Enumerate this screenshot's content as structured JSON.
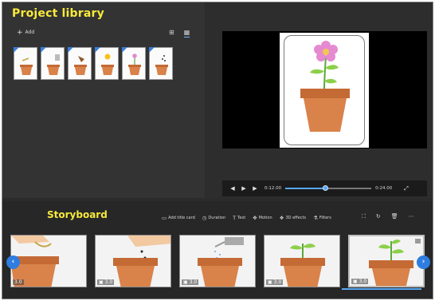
{
  "library": {
    "title": "Project library",
    "add_label": "Add",
    "view_grid_icon": "grid-view-icon",
    "view_list_icon": "list-view-icon"
  },
  "preview": {
    "current_time": "0:12.00",
    "total_time": "0:24.00",
    "progress": 0.47
  },
  "storyboard": {
    "title": "Storyboard",
    "tools": [
      {
        "icon": "title-card-icon",
        "label": "Add title card"
      },
      {
        "icon": "duration-icon",
        "label": "Duration"
      },
      {
        "icon": "text-icon",
        "label": "Text"
      },
      {
        "icon": "motion-icon",
        "label": "Motion"
      },
      {
        "icon": "3d-effects-icon",
        "label": "3D effects"
      },
      {
        "icon": "filters-icon",
        "label": "Filters"
      }
    ],
    "clips": [
      {
        "duration": "3.0"
      },
      {
        "duration": "3.0"
      },
      {
        "duration": "3.0"
      },
      {
        "duration": "3.0"
      },
      {
        "duration": "3.0"
      }
    ]
  },
  "colors": {
    "title_yellow": "#f7e93b",
    "accent_blue": "#2f7de0",
    "pot_orange": "#d9824a"
  }
}
